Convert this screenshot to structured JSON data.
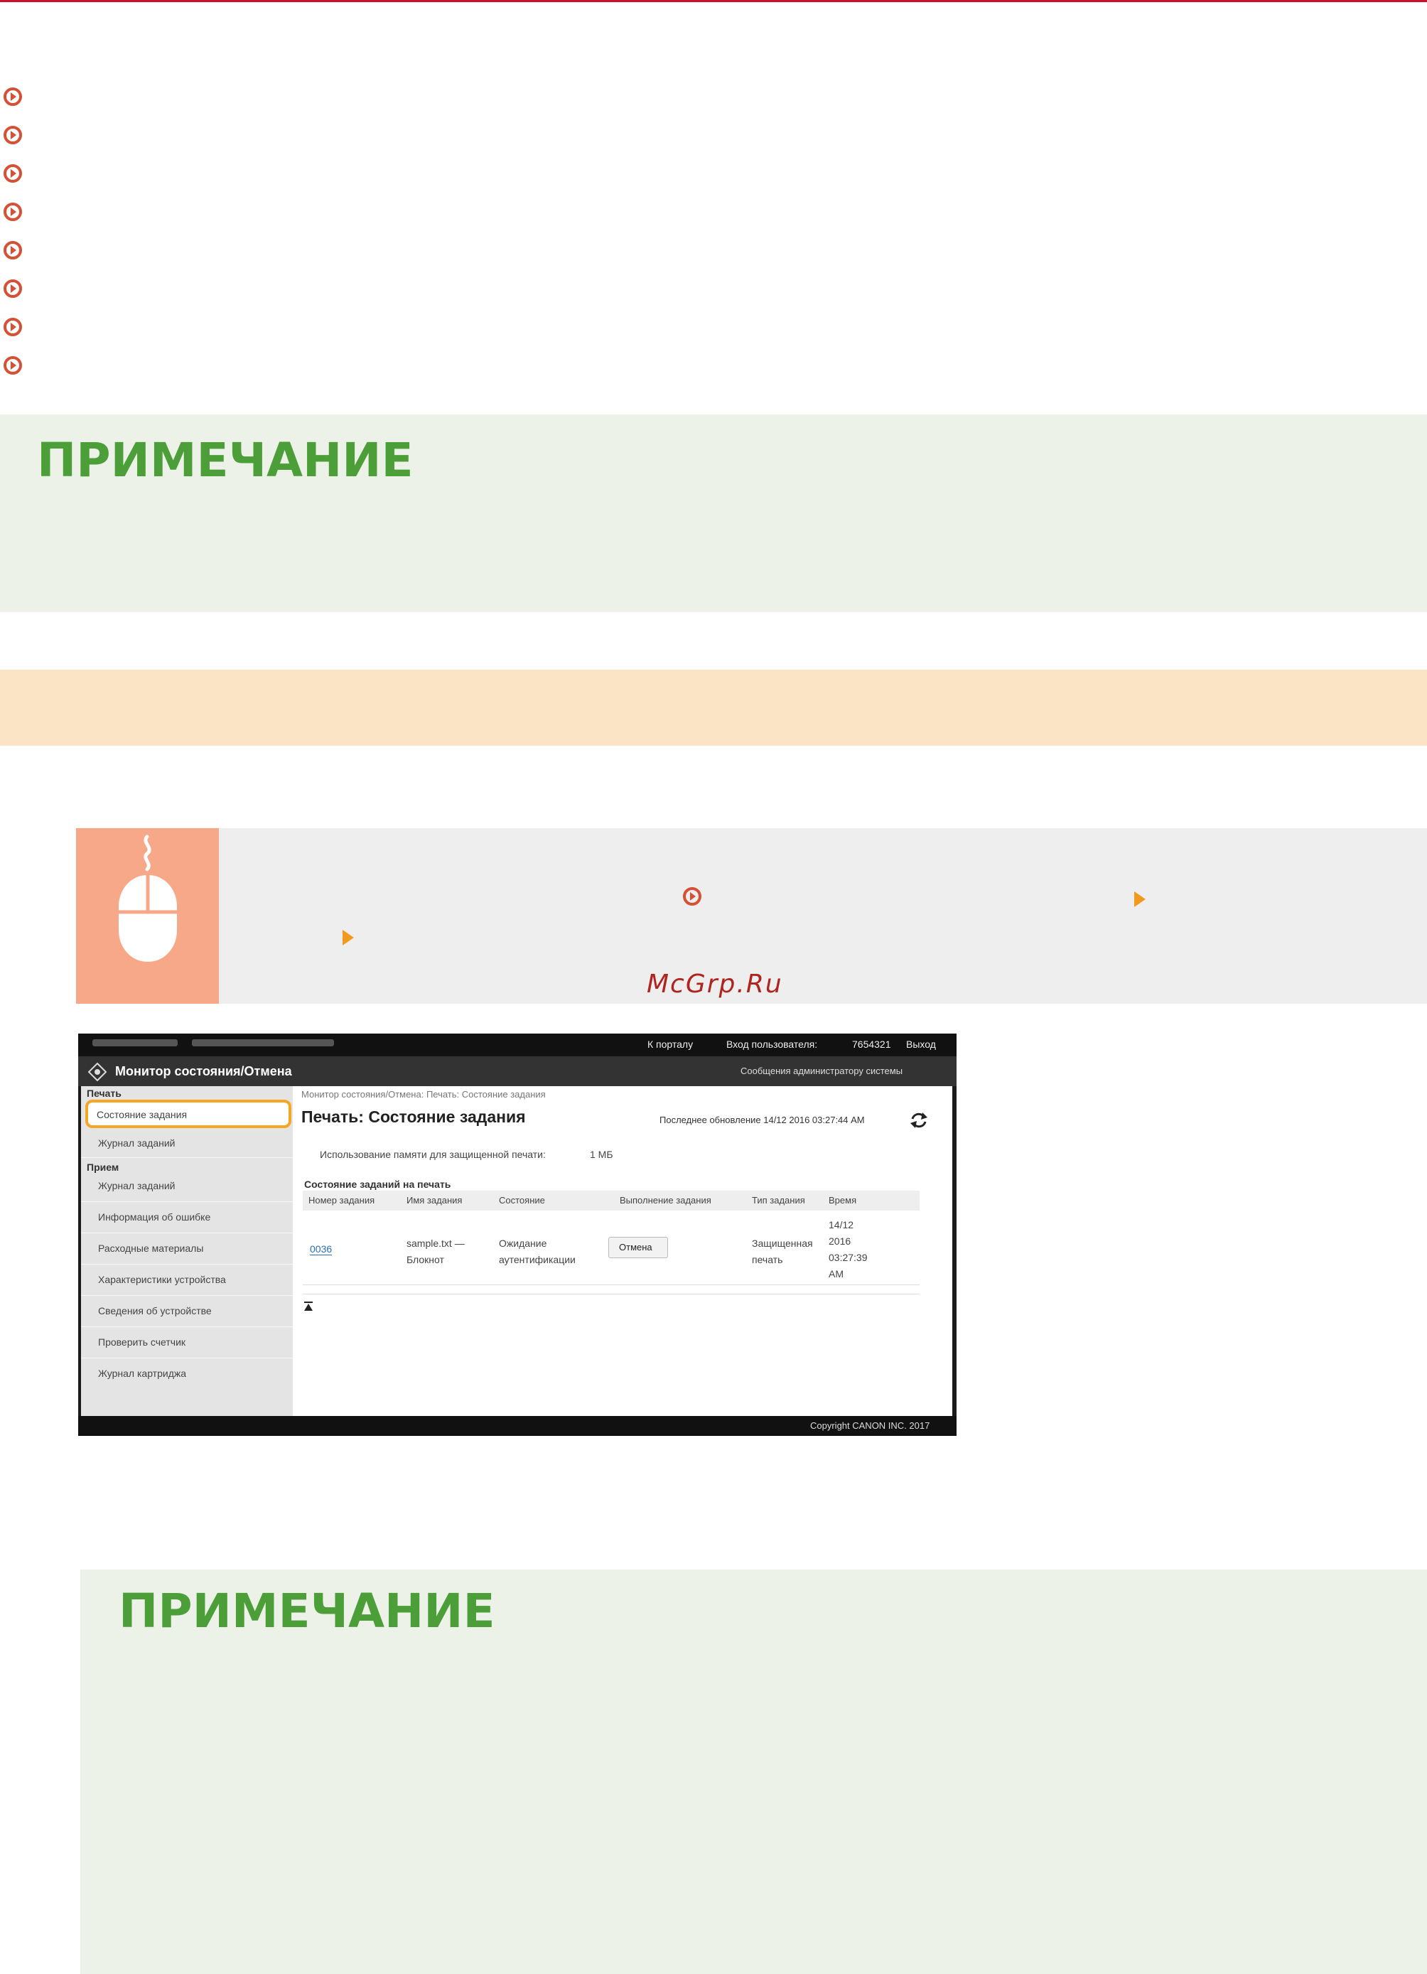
{
  "watermark": "McGrp.Ru",
  "notes": {
    "note1_title": "ПРИМЕЧАНИЕ",
    "note2_title": "ПРИМЕЧАНИЕ"
  },
  "colors": {
    "accent_red": "#c8102e",
    "note_green": "#4c9f38",
    "note_bg": "#edf2e8",
    "bar_orange": "#fbe4c5",
    "mouse_icon_bg": "#f6a889",
    "arrow_orange": "#f29a1e"
  },
  "icons": {
    "bullet": "circle-arrow-icon",
    "step": "mouse-icon",
    "arrow": "triangle-arrow-icon"
  },
  "screenshot": {
    "top_bar": {
      "portal_link": "К порталу",
      "login_label": "Вход пользователя:",
      "login_user": "7654321",
      "logout_link": "Выход"
    },
    "app_title": "Монитор состояния/Отмена",
    "admin_message_link": "Сообщения администратору системы",
    "sidebar": {
      "section_print": "Печать",
      "item_job_status": "Состояние задания",
      "item_job_log": "Журнал заданий",
      "section_receive": "Прием",
      "item_receive_log": "Журнал заданий",
      "items": [
        "Информация об ошибке",
        "Расходные материалы",
        "Характеристики устройства",
        "Сведения об устройстве",
        "Проверить счетчик",
        "Журнал картриджа"
      ]
    },
    "main": {
      "breadcrumb": "Монитор состояния/Отмена: Печать: Состояние задания",
      "page_title": "Печать: Состояние задания",
      "last_update": "Последнее обновление 14/12 2016 03:27:44 AM",
      "memory_label": "Использование памяти для защищенной печати:",
      "memory_value": "1 МБ",
      "table_caption": "Состояние заданий на печать",
      "columns": [
        "Номер задания",
        "Имя задания",
        "Состояние",
        "Выполнение задания",
        "Тип задания",
        "Время"
      ],
      "row": {
        "job_no": "0036",
        "job_name_1": "sample.txt —",
        "job_name_2": "Блокнот",
        "status_1": "Ожидание",
        "status_2": "аутентификации",
        "action_button": "Отмена",
        "type_1": "Защищенная",
        "type_2": "печать",
        "time_1": "14/12",
        "time_2": "2016",
        "time_3": "03:27:39",
        "time_4": "AM"
      }
    },
    "footer": "Copyright CANON INC. 2017"
  }
}
